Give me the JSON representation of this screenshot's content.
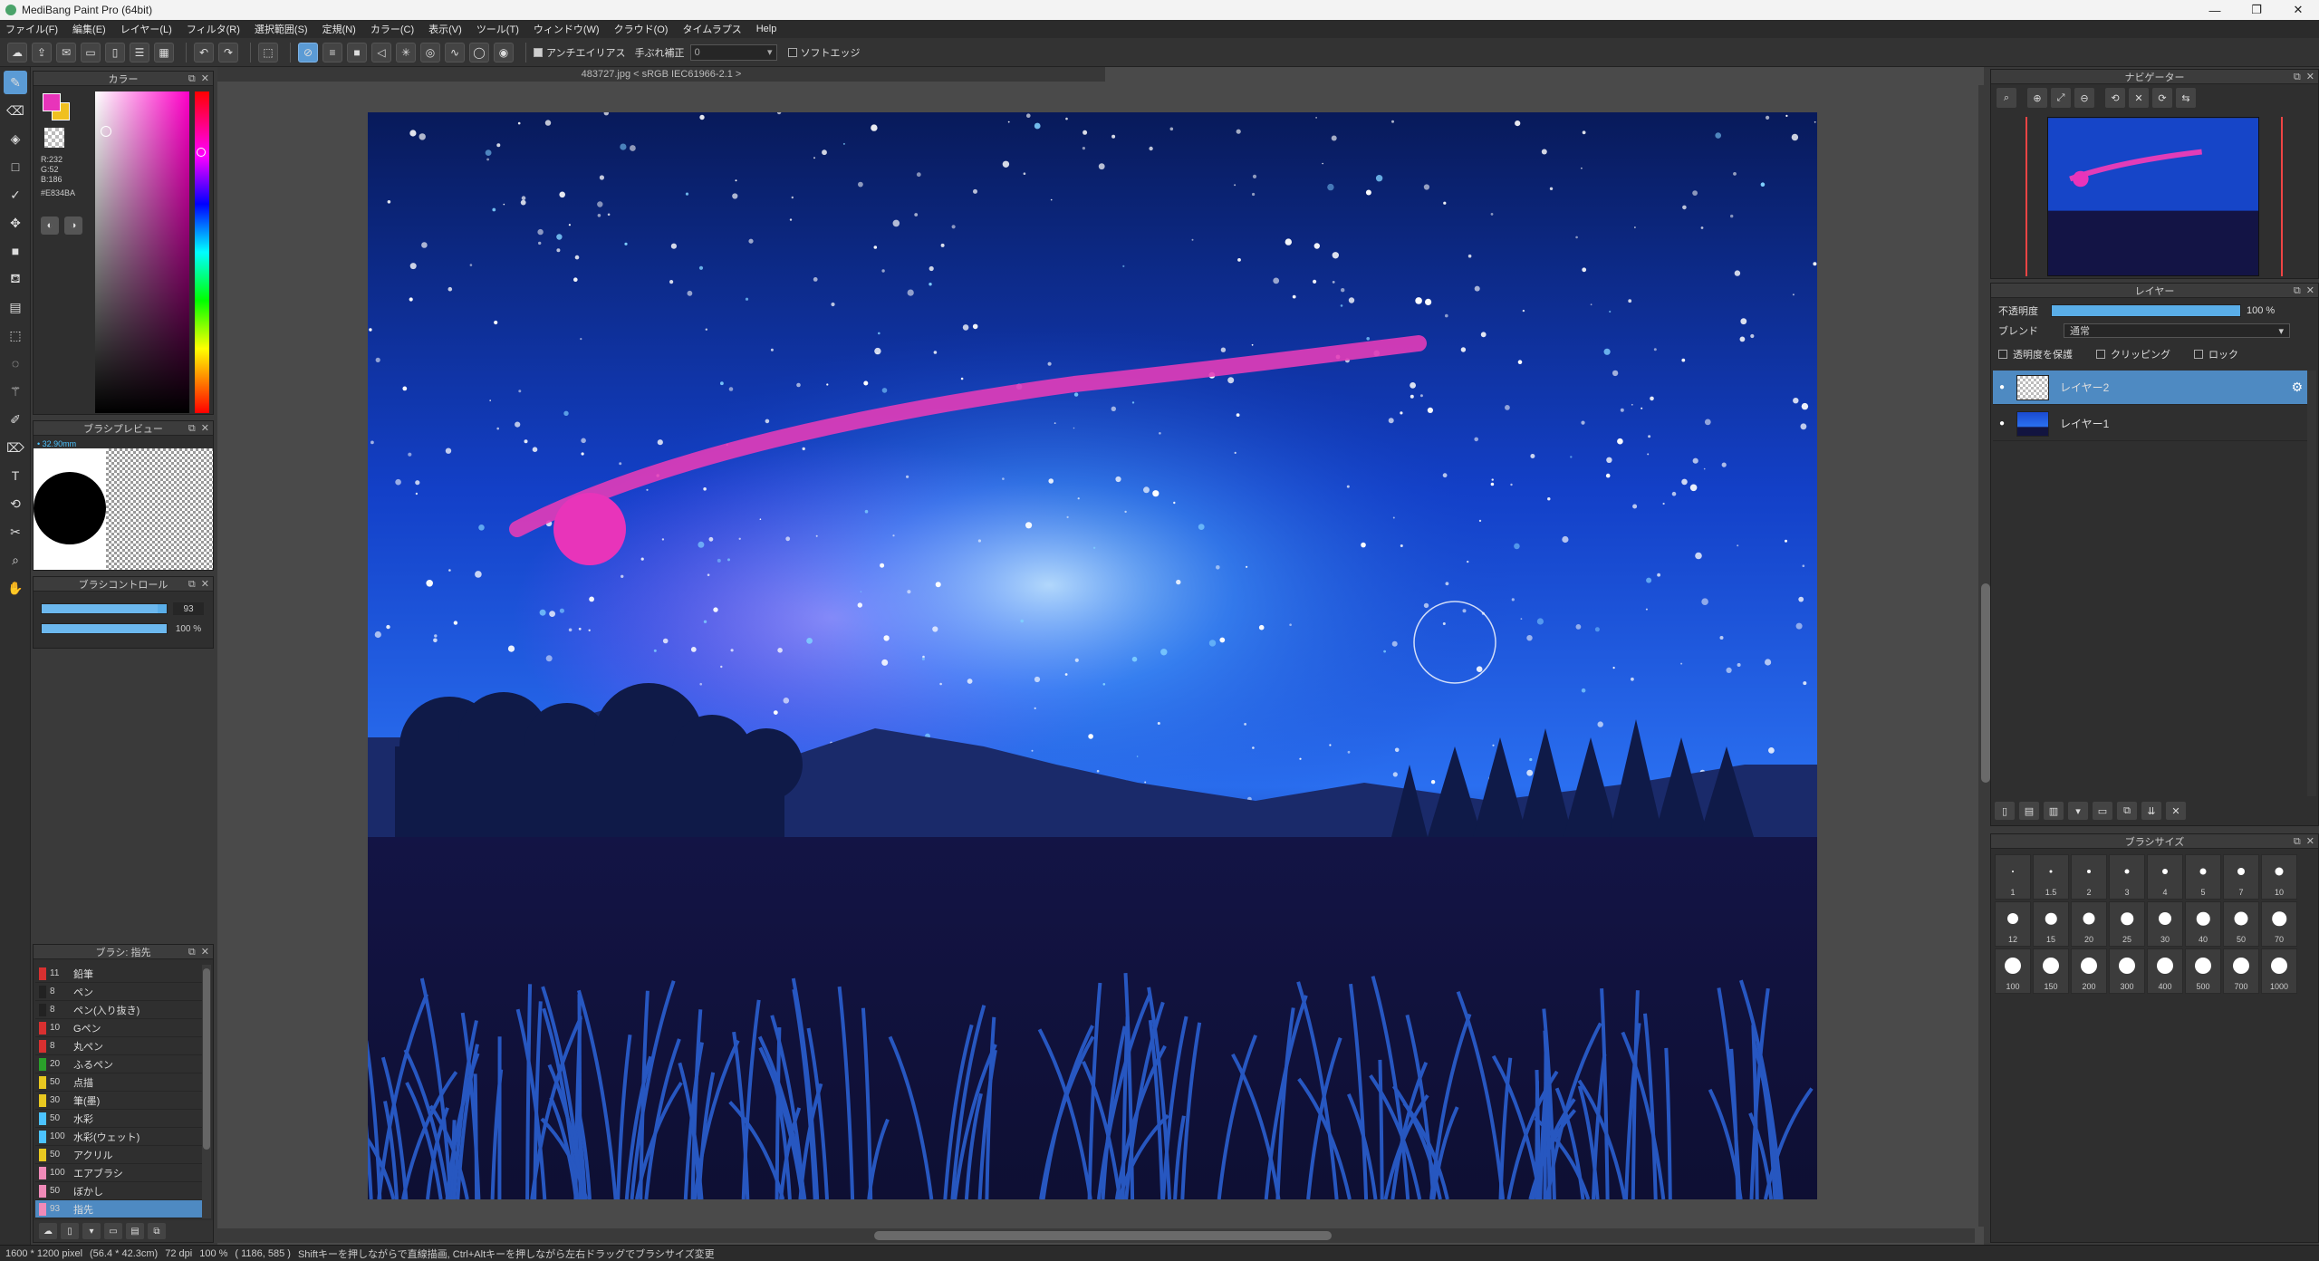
{
  "window": {
    "title": "MediBang Paint Pro (64bit)",
    "controls": [
      "—",
      "❐",
      "✕"
    ]
  },
  "menu": [
    "ファイル(F)",
    "編集(E)",
    "レイヤー(L)",
    "フィルタ(R)",
    "選択範囲(S)",
    "定規(N)",
    "カラー(C)",
    "表示(V)",
    "ツール(T)",
    "ウィンドウ(W)",
    "クラウド(O)",
    "タイムラプス",
    "Help"
  ],
  "toolbar": {
    "antialias_label": "アンチエイリアス",
    "stabilizer_label": "手ぶれ補正",
    "stabilizer_value": "0",
    "soft_edge_label": "ソフトエッジ"
  },
  "color_panel": {
    "title": "カラー",
    "r": "R:232",
    "g": "G:52",
    "b": "B:186",
    "hex": "#E834BA",
    "foreground": "#e834ba",
    "background": "#f0c020"
  },
  "brush_preview": {
    "title": "ブラシプレビュー",
    "size": "• 32.90mm"
  },
  "brush_control": {
    "title": "ブラシコントロール",
    "size_value": "93",
    "opacity_value": "100 %"
  },
  "brush_list": {
    "title": "ブラシ: 指先",
    "items": [
      {
        "color": "#d83030",
        "size": "11",
        "name": "鉛筆"
      },
      {
        "color": "#222222",
        "size": "8",
        "name": "ペン"
      },
      {
        "color": "#222222",
        "size": "8",
        "name": "ペン(入り抜き)"
      },
      {
        "color": "#d83030",
        "size": "10",
        "name": "Gペン"
      },
      {
        "color": "#d83030",
        "size": "8",
        "name": "丸ペン"
      },
      {
        "color": "#2aa02a",
        "size": "20",
        "name": "ふるペン"
      },
      {
        "color": "#e8c820",
        "size": "50",
        "name": "点描"
      },
      {
        "color": "#e8c820",
        "size": "30",
        "name": "筆(墨)"
      },
      {
        "color": "#4cc3ff",
        "size": "50",
        "name": "水彩"
      },
      {
        "color": "#4cc3ff",
        "size": "100",
        "name": "水彩(ウェット)"
      },
      {
        "color": "#e8c820",
        "size": "50",
        "name": "アクリル"
      },
      {
        "color": "#f08ab8",
        "size": "100",
        "name": "エアブラシ"
      },
      {
        "color": "#f08ab8",
        "size": "50",
        "name": "ぼかし"
      },
      {
        "color": "#f08ab8",
        "size": "93",
        "name": "指先"
      }
    ]
  },
  "canvas": {
    "tab": "483727.jpg < sRGB IEC61966-2.1 >"
  },
  "navigator": {
    "title": "ナビゲーター"
  },
  "layer_panel": {
    "title": "レイヤー",
    "opacity_label": "不透明度",
    "opacity_value": "100 %",
    "blend_label": "ブレンド",
    "blend_value": "通常",
    "protect_alpha": "透明度を保護",
    "clipping": "クリッピング",
    "lock": "ロック",
    "layers": [
      {
        "name": "レイヤー2"
      },
      {
        "name": "レイヤー1"
      }
    ]
  },
  "brush_size_panel": {
    "title": "ブラシサイズ",
    "sizes": [
      "1",
      "1.5",
      "2",
      "3",
      "4",
      "5",
      "7",
      "10",
      "12",
      "15",
      "20",
      "25",
      "30",
      "40",
      "50",
      "70",
      "100",
      "150",
      "200",
      "300",
      "400",
      "500",
      "700",
      "1000"
    ]
  },
  "status": {
    "dims": "1600 * 1200 pixel",
    "physical": "(56.4 * 42.3cm)",
    "dpi": "72 dpi",
    "zoom": "100 %",
    "coords": "( 1186, 585 )",
    "hint": "Shiftキーを押しながらで直線描画, Ctrl+Altキーを押しながら左右ドラッグでブラシサイズ変更"
  },
  "icons": {
    "undo": "↶",
    "redo": "↷",
    "gear": "⚙"
  }
}
